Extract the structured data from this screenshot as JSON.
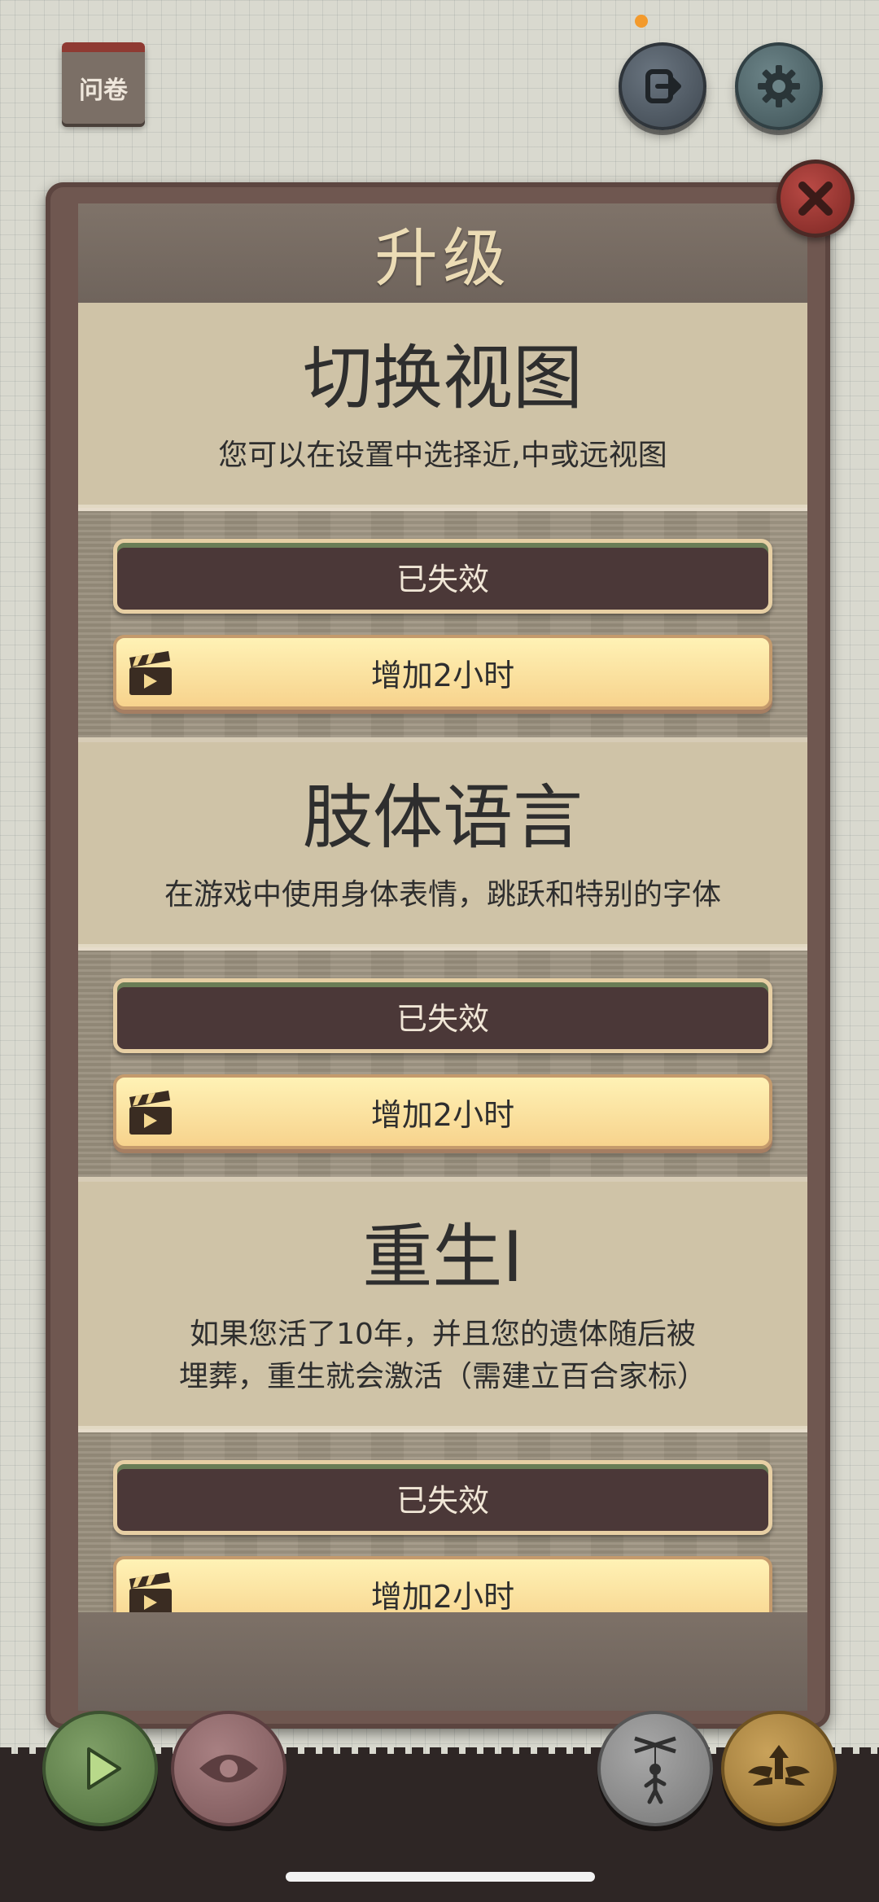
{
  "top_bar": {
    "survey_label": "问卷"
  },
  "modal": {
    "title": "升级",
    "features": [
      {
        "title": "切换视图",
        "description": "您可以在设置中选择近,中或远视图",
        "status_label": "已失效",
        "add_label": "增加2小时"
      },
      {
        "title": "肢体语言",
        "description": "在游戏中使用身体表情，跳跃和特别的字体",
        "status_label": "已失效",
        "add_label": "增加2小时"
      },
      {
        "title": "重生I",
        "description": "如果您活了10年，并且您的遗体随后被埋葬，重生就会激活（需建立百合家标）",
        "status_label": "已失效",
        "add_label": "增加2小时"
      }
    ]
  },
  "icons": {
    "exit": "exit-icon",
    "settings": "gear-icon",
    "close": "close-icon",
    "video": "clapperboard-icon",
    "play": "play-icon",
    "view": "eye-icon",
    "puppet": "puppet-icon",
    "upgrade": "wings-icon"
  },
  "colors": {
    "background": "#d9d9cf",
    "modal_title": "#ecdcb5",
    "disabled_button": "#4b3838",
    "add_button": "#f7d38d",
    "close_button": "#b94a45"
  }
}
